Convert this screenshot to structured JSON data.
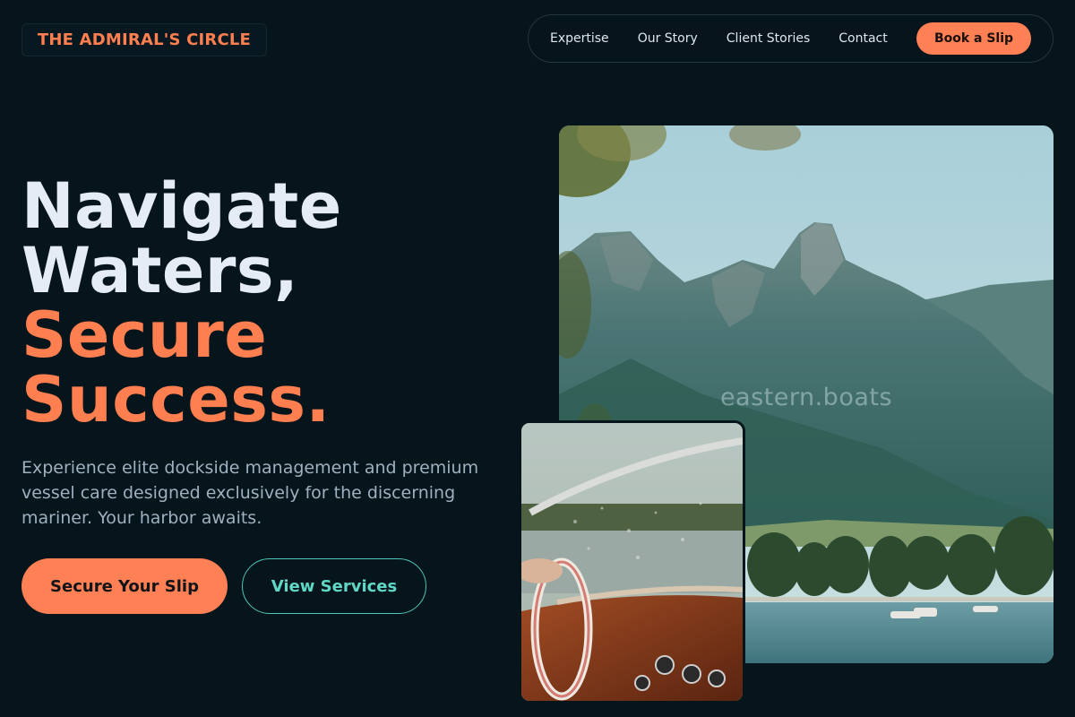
{
  "brand": {
    "logo_text": "THE ADMIRAL'S CIRCLE",
    "accent_color": "#ff7f50",
    "teal_color": "#5fd8c6",
    "background_color": "#06141b"
  },
  "nav": {
    "items": [
      {
        "label": "Expertise"
      },
      {
        "label": "Our Story"
      },
      {
        "label": "Client Stories"
      },
      {
        "label": "Contact"
      }
    ],
    "cta_label": "Book a Slip"
  },
  "hero": {
    "headline_line1": "Navigate",
    "headline_line2": "Waters,",
    "headline_line3": "Secure",
    "headline_line4": "Success.",
    "subcopy": "Experience elite dockside management and premium vessel care designed exclusively for the discerning mariner. Your harbor awaits.",
    "primary_button": "Secure Your Slip",
    "secondary_button": "View Services"
  },
  "media": {
    "main_image_watermark": "eastern.boats",
    "main_image_subject": "mountain-lake-marina-photo",
    "inset_image_subject": "boat-steering-wheel-photo"
  }
}
